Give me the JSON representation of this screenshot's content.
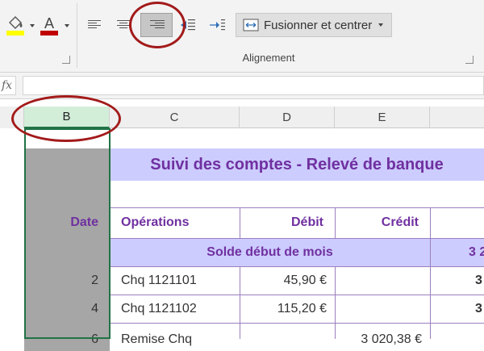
{
  "ribbon": {
    "merge_label": "Fusionner et centrer",
    "group_label": "Alignement"
  },
  "formula_bar": {
    "fx": "fx",
    "value": ""
  },
  "columns": {
    "b": "B",
    "c": "C",
    "d": "D",
    "e": "E"
  },
  "sheet": {
    "title": "Suivi des comptes - Relevé de banque",
    "headers": {
      "date": "Date",
      "operations": "Opérations",
      "debit": "Débit",
      "credit": "Crédit"
    },
    "opening": {
      "label": "Solde début de mois",
      "balance_partial": "3 2"
    },
    "rows": [
      {
        "date": "2",
        "operation": "Chq 1121101",
        "debit": "45,90 €",
        "credit": "",
        "balance_partial": "3"
      },
      {
        "date": "4",
        "operation": "Chq 1121102",
        "debit": "115,20 €",
        "credit": "",
        "balance_partial": "3"
      },
      {
        "date": "6",
        "operation": "Remise Chq",
        "debit": "",
        "credit": "3 020,38 €",
        "balance_partial": ""
      }
    ]
  },
  "colors": {
    "title_band": "#ccccff",
    "grey_band": "#a6a6a6",
    "text_purple": "#7030a0",
    "selection_green": "#217346",
    "annotation_red": "#a31a1a"
  }
}
